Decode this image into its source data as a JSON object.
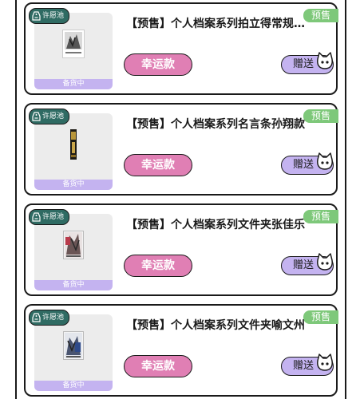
{
  "colors": {
    "card_border": "#1a1a1a",
    "pool_badge_bg": "#2f6b63",
    "presale_tag_bg": "#7ec87a",
    "lucky_button_bg": "#e07fb4",
    "gift_button_bg": "#c4b3f0",
    "status_bar_bg": "#c4b3f0",
    "thumb_bg": "#ececec"
  },
  "products": [
    {
      "pool_badge": "许愿池",
      "pool_icon": "tag-icon",
      "presale_tag": "预售",
      "title": "【预售】个人档案系列拍立得常规…",
      "status": "备货中",
      "lucky_label": "幸运款",
      "gift_label": "赠送",
      "gift_icon": "cat-icon",
      "art": "photo-card-image"
    },
    {
      "pool_badge": "许愿池",
      "pool_icon": "tag-icon",
      "presale_tag": "预售",
      "title": "【预售】个人档案系列名言条孙翔款",
      "status": "备货中",
      "lucky_label": "幸运款",
      "gift_label": "赠送",
      "gift_icon": "cat-icon",
      "art": "bookmark-strip-image"
    },
    {
      "pool_badge": "许愿池",
      "pool_icon": "tag-icon",
      "presale_tag": "预售",
      "title": "【预售】个人档案系列文件夹张佳乐",
      "status": "备货中",
      "lucky_label": "幸运款",
      "gift_label": "赠送",
      "gift_icon": "cat-icon",
      "art": "folder-image"
    },
    {
      "pool_badge": "许愿池",
      "pool_icon": "tag-icon",
      "presale_tag": "预售",
      "title": "【预售】个人档案系列文件夹喻文州",
      "status": "备货中",
      "lucky_label": "幸运款",
      "gift_label": "赠送",
      "gift_icon": "cat-icon",
      "art": "folder-image"
    }
  ]
}
